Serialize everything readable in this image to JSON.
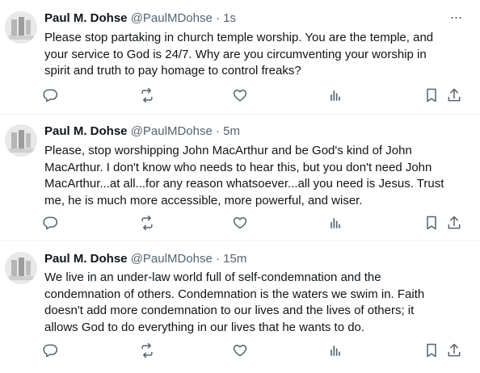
{
  "tweets": [
    {
      "name": "Paul M. Dohse",
      "handle": "@PaulMDohse",
      "separator": "·",
      "time": "1s",
      "text": "Please stop partaking in church temple worship. You are the temple, and\nyour service to God is 24/7. Why are you circumventing your worship in\nspirit and truth to pay homage to control freaks?"
    },
    {
      "name": "Paul M. Dohse",
      "handle": "@PaulMDohse",
      "separator": "·",
      "time": "5m",
      "text": "Please, stop worshipping John MacArthur and be God's kind of John\nMacArthur. I don't know who needs to hear this, but you don't need John\nMacArthur...at all...for any reason whatsoever...all you need is Jesus. Trust\nme, he is much more accessible, more powerful, and wiser."
    },
    {
      "name": "Paul M. Dohse",
      "handle": "@PaulMDohse",
      "separator": "·",
      "time": "15m",
      "text": "We live in an under-law world full of self-condemnation and the\ncondemnation of others. Condemnation is the waters we swim in. Faith\ndoesn't add more condemnation to our lives and the lives of others; it\nallows God to do everything in our lives that he wants to do."
    }
  ],
  "icons": {
    "more": "more-icon",
    "reply": "reply-icon",
    "retweet": "retweet-icon",
    "like": "like-icon",
    "views": "views-icon",
    "bookmark": "bookmark-icon",
    "share": "share-icon"
  },
  "colors": {
    "text": "#0f1419",
    "secondary": "#536471",
    "divider": "#eff3f4"
  },
  "more_glyph": "···"
}
